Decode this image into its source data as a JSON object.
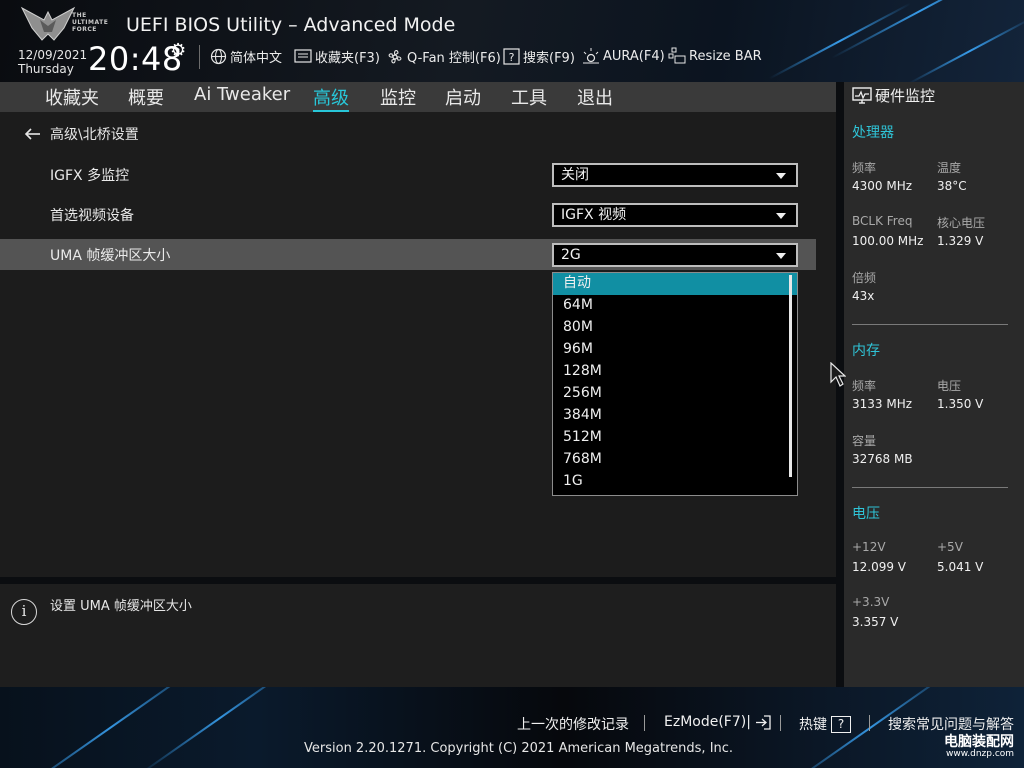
{
  "header": {
    "logo_text": "THE ULTIMATE FORCE",
    "title": "UEFI BIOS Utility – Advanced Mode",
    "date": "12/09/2021",
    "weekday": "Thursday",
    "time": "20:48",
    "tools": [
      {
        "label": "简体中文",
        "icon": "globe-icon"
      },
      {
        "label": "收藏夹(F3)",
        "icon": "favorites-icon"
      },
      {
        "label": "Q-Fan 控制(F6)",
        "icon": "fan-icon"
      },
      {
        "label": "搜索(F9)",
        "icon": "search-help-icon"
      },
      {
        "label": "AURA(F4)",
        "icon": "aura-icon"
      },
      {
        "label": "Resize BAR",
        "icon": "resize-bar-icon"
      }
    ]
  },
  "nav": {
    "tabs": [
      "收藏夹",
      "概要",
      "Ai Tweaker",
      "高级",
      "监控",
      "启动",
      "工具",
      "退出"
    ],
    "active": "高级"
  },
  "main": {
    "breadcrumb": "高级\\北桥设置",
    "rows": [
      {
        "label": "IGFX 多监控",
        "value": "关闭"
      },
      {
        "label": "首选视频设备",
        "value": "IGFX 视频"
      },
      {
        "label": "UMA 帧缓冲区大小",
        "value": "2G"
      }
    ],
    "dropdown_options": [
      "自动",
      "64M",
      "80M",
      "96M",
      "128M",
      "256M",
      "384M",
      "512M",
      "768M",
      "1G"
    ],
    "dropdown_highlighted": "自动"
  },
  "info": {
    "text": "设置 UMA 帧缓冲区大小"
  },
  "monitor": {
    "title": "硬件监控",
    "cpu": {
      "heading": "处理器",
      "freq_label": "频率",
      "freq": "4300 MHz",
      "temp_label": "温度",
      "temp": "38°C",
      "bclk_label": "BCLK Freq",
      "bclk": "100.00 MHz",
      "vcore_label": "核心电压",
      "vcore": "1.329 V",
      "ratio_label": "倍频",
      "ratio": "43x"
    },
    "memory": {
      "heading": "内存",
      "freq_label": "频率",
      "freq": "3133 MHz",
      "volt_label": "电压",
      "volt": "1.350 V",
      "cap_label": "容量",
      "cap": "32768 MB"
    },
    "voltage": {
      "heading": "电压",
      "v12_label": "+12V",
      "v12": "12.099 V",
      "v5_label": "+5V",
      "v5": "5.041 V",
      "v33_label": "+3.3V",
      "v33": "3.357 V"
    }
  },
  "footer": {
    "last_modified": "上一次的修改记录",
    "ezmode": "EzMode(F7)|",
    "hotkeys": "热键",
    "hotkeys_key": "?",
    "faq": "搜索常见问题与解答",
    "copyright": "Version 2.20.1271. Copyright (C) 2021 American Megatrends, Inc.",
    "watermark": "电脑装配网",
    "watermark_url": "www.dnzp.com"
  },
  "colors": {
    "accent": "#28c6d8",
    "selected_option": "#118fa3",
    "highlight_row": "#545454"
  }
}
